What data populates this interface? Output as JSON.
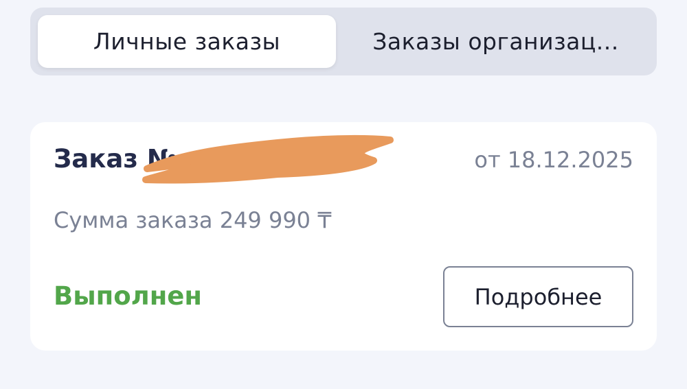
{
  "tabs": [
    {
      "label": "Личные заказы",
      "active": true
    },
    {
      "label": "Заказы организац...",
      "active": false
    }
  ],
  "order": {
    "title": "Заказ №",
    "date": "от 18.12.2025",
    "sum": "Сумма заказа 249 990 ₸",
    "status": "Выполнен",
    "details_label": "Подробнее"
  },
  "colors": {
    "status": "#52a64a",
    "title": "#242b4b",
    "muted": "#7a8194",
    "redaction": "#e89a5c"
  }
}
